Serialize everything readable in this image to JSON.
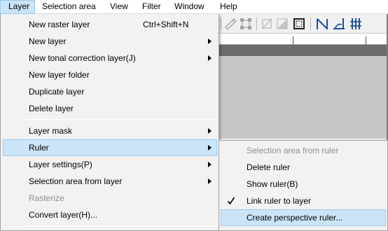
{
  "menubar": {
    "items": [
      {
        "label": "Layer",
        "active": true
      },
      {
        "label": "Selection area"
      },
      {
        "label": "View"
      },
      {
        "label": "Filter"
      },
      {
        "label": "Window"
      },
      {
        "label": "Help"
      }
    ]
  },
  "toolbar": {
    "icons": [
      "transform-icon",
      "corner-handles-icon",
      "crop-disabled-icon",
      "fill-disabled-icon",
      "selection-frame-icon",
      "ruler-icon",
      "angle-ruler-icon",
      "perspective-grid-icon"
    ],
    "accent": "#1f4e9c"
  },
  "layer_menu": {
    "items": [
      {
        "label": "New raster layer",
        "shortcut": "Ctrl+Shift+N"
      },
      {
        "label": "New layer",
        "submenu": true
      },
      {
        "label": "New tonal correction layer(J)",
        "submenu": true
      },
      {
        "label": "New layer folder"
      },
      {
        "label": "Duplicate layer"
      },
      {
        "label": "Delete layer"
      },
      {
        "label": "Layer mask",
        "submenu": true
      },
      {
        "label": "Ruler",
        "submenu": true,
        "highlighted": true
      },
      {
        "label": "Layer settings(P)",
        "submenu": true
      },
      {
        "label": "Selection area from layer",
        "submenu": true
      },
      {
        "label": "Rasterize",
        "disabled": true
      },
      {
        "label": "Convert layer(H)..."
      }
    ]
  },
  "ruler_submenu": {
    "items": [
      {
        "label": "Selection area from ruler",
        "disabled": true
      },
      {
        "label": "Delete ruler"
      },
      {
        "label": "Show ruler(B)"
      },
      {
        "label": "Link ruler to layer",
        "checked": true
      },
      {
        "label": "Create perspective ruler...",
        "highlighted": true
      }
    ]
  },
  "colors": {
    "highlight_bg": "#cce4f7",
    "highlight_border": "#99c9ef",
    "menu_bg": "#f2f2f2",
    "disabled_text": "#8e8e8e"
  }
}
